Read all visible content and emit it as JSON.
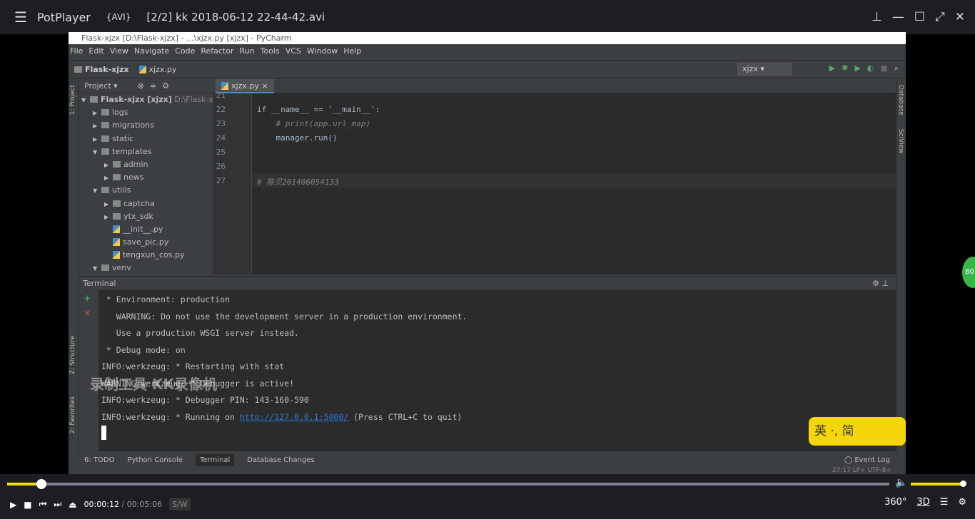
{
  "player": {
    "brand": "PotPlayer",
    "format": "{AVI}",
    "file": "[2/2] kk 2018-06-12 22-44-42.avi",
    "current_time": "00:00:12",
    "total_time": "00:05:06",
    "sw_label": "S/W",
    "progress_percent": 3.9,
    "volume_percent": 100,
    "accent": "#f0e000",
    "btn_360": "360°",
    "btn_3d": "3D"
  },
  "ide": {
    "title": "Flask-xjzx [D:\\Flask-xjzx] - ...\\xjzx.py [xjzx] - PyCharm",
    "menu": [
      "File",
      "Edit",
      "View",
      "Navigate",
      "Code",
      "Refactor",
      "Run",
      "Tools",
      "VCS",
      "Window",
      "Help"
    ],
    "breadcrumb": [
      "Flask-xjzx",
      "xjzx.py"
    ],
    "run_config": "xjzx",
    "project_label": "Project",
    "left_tools": [
      "1: Project",
      "Z: Structure",
      "2: Favorites"
    ],
    "right_tools": [
      "Database",
      "SciView"
    ],
    "tree": [
      {
        "label": "Flask-xjzx [xjzx]",
        "extra": "D:\\Flask-xjzx",
        "depth": 0,
        "type": "folder",
        "open": true
      },
      {
        "label": "logs",
        "depth": 1,
        "type": "folder"
      },
      {
        "label": "migrations",
        "depth": 1,
        "type": "folder"
      },
      {
        "label": "static",
        "depth": 1,
        "type": "folder"
      },
      {
        "label": "templates",
        "depth": 1,
        "type": "folder",
        "open": true
      },
      {
        "label": "admin",
        "depth": 2,
        "type": "folder"
      },
      {
        "label": "news",
        "depth": 2,
        "type": "folder"
      },
      {
        "label": "utills",
        "depth": 1,
        "type": "folder",
        "open": true
      },
      {
        "label": "captcha",
        "depth": 2,
        "type": "folder"
      },
      {
        "label": "ytx_sdk",
        "depth": 2,
        "type": "folder"
      },
      {
        "label": "__init__.py",
        "depth": 2,
        "type": "py"
      },
      {
        "label": "save_pic.py",
        "depth": 2,
        "type": "py"
      },
      {
        "label": "tengxun_cos.py",
        "depth": 2,
        "type": "py"
      },
      {
        "label": "venv",
        "depth": 1,
        "type": "folder",
        "open": true
      }
    ],
    "tab": "xjzx.py",
    "code": [
      {
        "n": "21",
        "t": ""
      },
      {
        "n": "22",
        "t": "if __name__ == '__main__':"
      },
      {
        "n": "23",
        "t": "    # print(app.url_map)",
        "comment": true
      },
      {
        "n": "24",
        "t": "    manager.run()"
      },
      {
        "n": "25",
        "t": ""
      },
      {
        "n": "26",
        "t": ""
      },
      {
        "n": "27",
        "t": "# 陈贝201406054133",
        "comment": true
      }
    ],
    "terminal_label": "Terminal",
    "terminal": [
      " * Environment: production",
      "   WARNING: Do not use the development server in a production environment.",
      "   Use a production WSGI server instead.",
      " * Debug mode: on",
      "INFO:werkzeug: * Restarting with stat",
      "WARNING:werkzeug: * Debugger is active!",
      "INFO:werkzeug: * Debugger PIN: 143-160-590"
    ],
    "terminal_last": {
      "prefix": "INFO:werkzeug: * Running on ",
      "link": "http://127.0.0.1:5000/",
      "suffix": " (Press CTRL+C to quit)"
    },
    "bottom_tabs": [
      "6: TODO",
      "Python Console",
      "Terminal",
      "Database Changes"
    ],
    "event_log": "Event Log",
    "status": "27:17   LF÷   UTF-8÷"
  },
  "overlay": {
    "watermark": "录制工具 KK录像机",
    "ime": "英 ·, 简",
    "badge": "80"
  }
}
